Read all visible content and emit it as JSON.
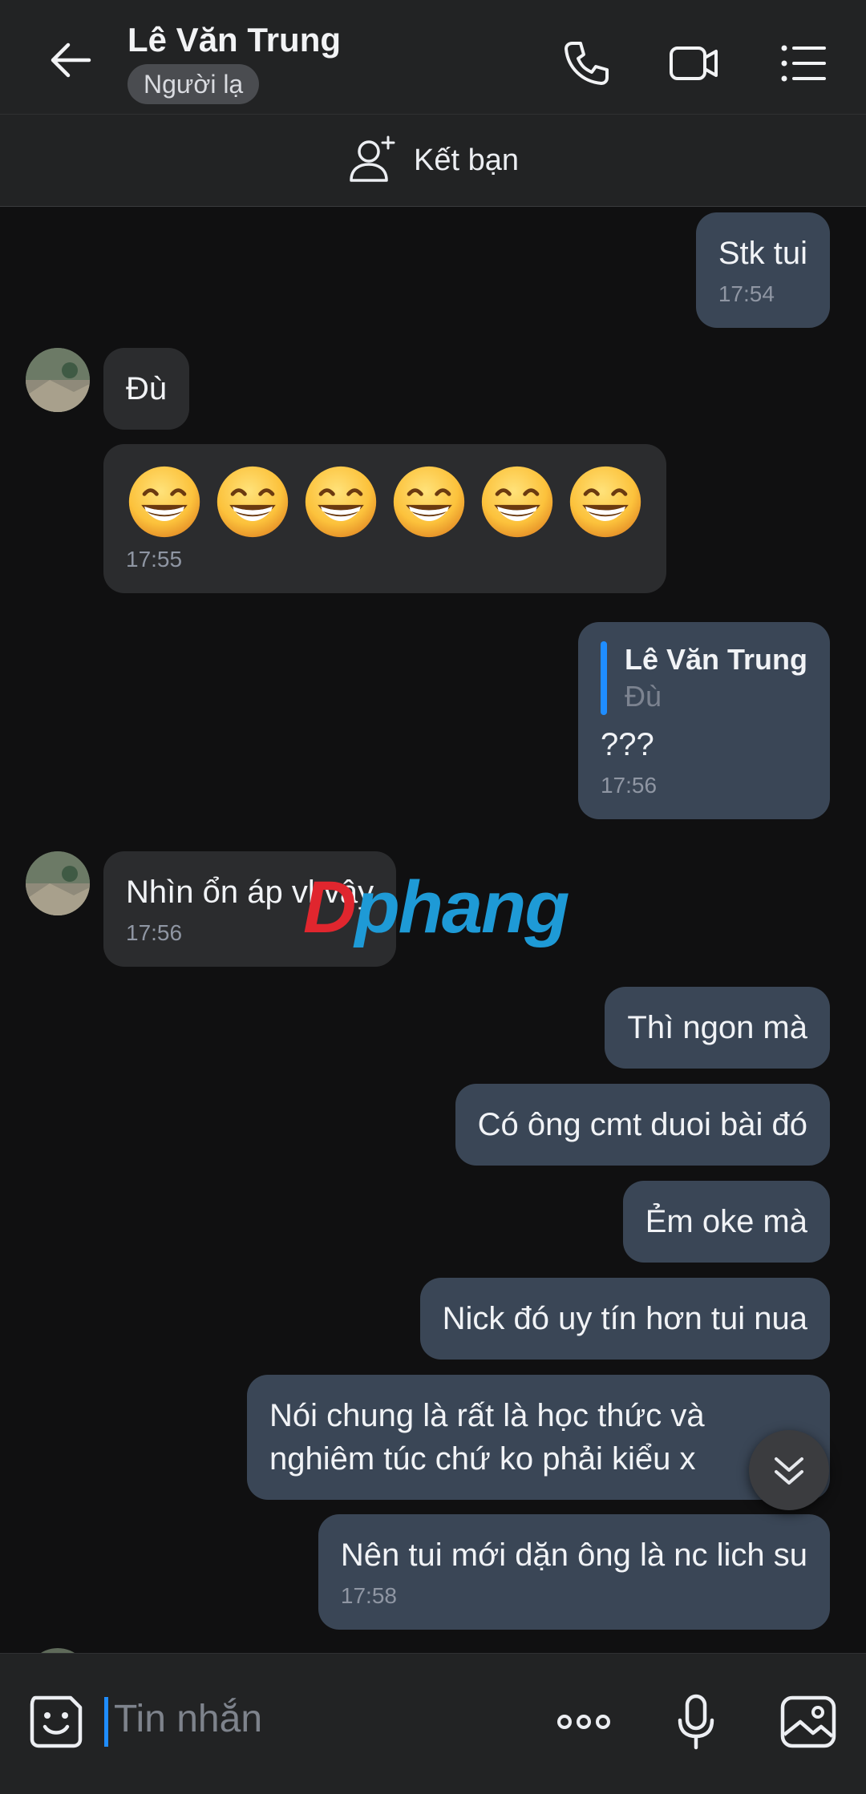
{
  "header": {
    "title": "Lê Văn Trung",
    "badge": "Người lạ",
    "add_friend_label": "Kết bạn"
  },
  "messages": [
    {
      "side": "me",
      "text": "Stk tui",
      "time": "17:54"
    },
    {
      "side": "them",
      "text": "Đù"
    },
    {
      "side": "them",
      "emoji": "grinning-face-with-smiling-eyes",
      "count": 6,
      "time": "17:55"
    },
    {
      "side": "me",
      "quote": {
        "author": "Lê Văn Trung",
        "text": "Đù"
      },
      "text": "???",
      "time": "17:56"
    },
    {
      "side": "them",
      "text": "Nhìn ổn áp vl vậy",
      "time": "17:56"
    },
    {
      "side": "me",
      "text": "Thì ngon mà"
    },
    {
      "side": "me",
      "text": "Có ông cmt duoi bài đó"
    },
    {
      "side": "me",
      "text": "Ẻm oke mà"
    },
    {
      "side": "me",
      "text": "Nick đó uy tín hơn tui nua"
    },
    {
      "side": "me",
      "lines": [
        "Nói chung là rất là học thức và",
        "nghiêm túc chứ ko phải kiểu x"
      ]
    },
    {
      "side": "me",
      "text": "Nên tui mới dặn ông là nc lich su",
      "time": "17:58"
    }
  ],
  "watermark": {
    "part1": "D",
    "part2": "phang"
  },
  "composer": {
    "placeholder": "Tin nhắn"
  },
  "colors": {
    "accent": "#1f8dff",
    "my_bubble": "#3a4656",
    "their_bubble": "#2b2c2e",
    "background": "#101011"
  },
  "icons": [
    "back-arrow-icon",
    "phone-icon",
    "video-call-icon",
    "list-menu-icon",
    "add-friend-icon",
    "sticker-icon",
    "more-options-icon",
    "microphone-icon",
    "image-icon",
    "chevron-double-down-icon",
    "grinning-face-emoji"
  ]
}
